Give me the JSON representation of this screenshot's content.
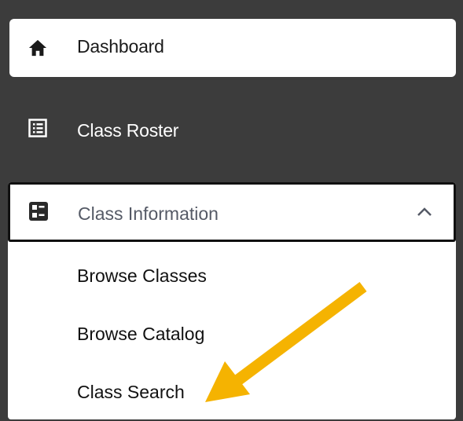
{
  "nav": {
    "dashboard": {
      "label": "Dashboard",
      "icon": "home-icon"
    },
    "class_roster": {
      "label": "Class Roster",
      "icon": "roster-list-icon"
    },
    "class_information": {
      "label": "Class Information",
      "icon": "class-info-icon",
      "expanded": true,
      "toggle_icon": "chevron-up-icon",
      "children": [
        {
          "label": "Browse Classes"
        },
        {
          "label": "Browse Catalog"
        },
        {
          "label": "Class Search"
        }
      ]
    }
  },
  "annotation": {
    "type": "arrow",
    "color": "#F5B301",
    "target": "Class Search"
  },
  "colors": {
    "sidebar_bg": "#3c3c3c",
    "card_bg": "#ffffff",
    "arrow": "#F5B301"
  }
}
